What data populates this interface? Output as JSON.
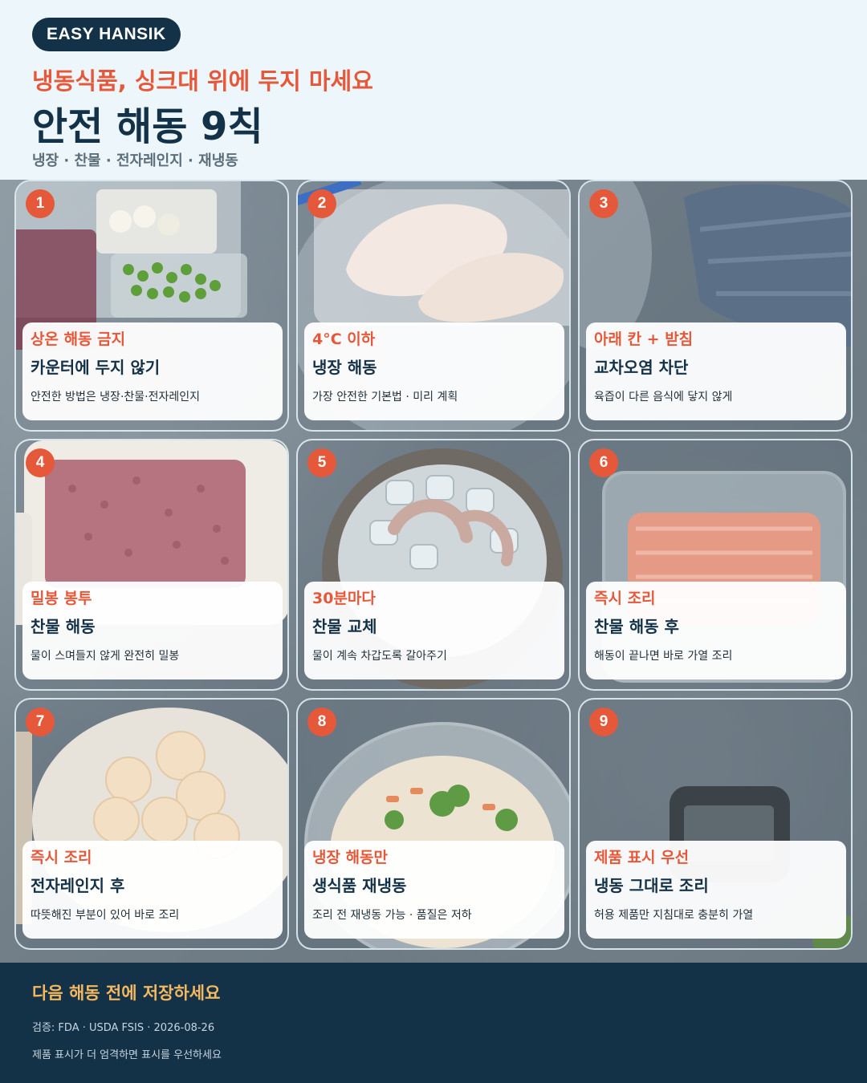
{
  "header": {
    "brand": "EASY HANSIK",
    "kicker": "냉동식품, 싱크대 위에 두지 마세요",
    "title": "안전 해동 9칙",
    "subtitle": "냉장 · 찬물 · 전자레인지 · 재냉동"
  },
  "tiles": [
    {
      "num": "1",
      "tag": "상온 해동 금지",
      "head": "카운터에 두지 않기",
      "desc": "안전한 방법은 냉장·찬물·전자레인지",
      "photo": "frozen-vegetables-in-containers"
    },
    {
      "num": "2",
      "tag": "4°C 이하",
      "head": "냉장 해동",
      "desc": "가장 안전한 기본법 · 미리 계획",
      "photo": "fish-fillets-in-zip-bag"
    },
    {
      "num": "3",
      "tag": "아래 칸 + 받침",
      "head": "교차오염 차단",
      "desc": "육즙이 다른 음식에 닿지 않게",
      "photo": "bowl-and-towel"
    },
    {
      "num": "4",
      "tag": "밀봉 봉투",
      "head": "찬물 해동",
      "desc": "물이 스며들지 않게 완전히 밀봉",
      "photo": "ground-meat-in-dish"
    },
    {
      "num": "5",
      "tag": "30분마다",
      "head": "찬물 교체",
      "desc": "물이 계속 차갑도록 갈아주기",
      "photo": "shrimp-on-ice"
    },
    {
      "num": "6",
      "tag": "즉시 조리",
      "head": "찬물 해동 후",
      "desc": "해동이 끝나면 바로 가열 조리",
      "photo": "salmon-in-glass-container"
    },
    {
      "num": "7",
      "tag": "즉시 조리",
      "head": "전자레인지 후",
      "desc": "따뜻해진 부분이 있어 바로 조리",
      "photo": "scallops-on-plate"
    },
    {
      "num": "8",
      "tag": "냉장 해동만",
      "head": "생식품 재냉동",
      "desc": "조리 전 재냉동 가능 · 품질은 저하",
      "photo": "rice-with-vegetables"
    },
    {
      "num": "9",
      "tag": "제품 표시 우선",
      "head": "냉동 그대로 조리",
      "desc": "허용 제품만 지침대로 충분히 가열",
      "photo": "thermometer"
    }
  ],
  "footer": {
    "cta": "다음 해동 전에 저장하세요",
    "source": "검증: FDA · USDA FSIS · 2026-08-26",
    "note": "제품 표시가 더 엄격하면 표시를 우선하세요"
  },
  "colors": {
    "accent": "#e5593a",
    "navy": "#143247",
    "footer_highlight": "#f4b860"
  }
}
